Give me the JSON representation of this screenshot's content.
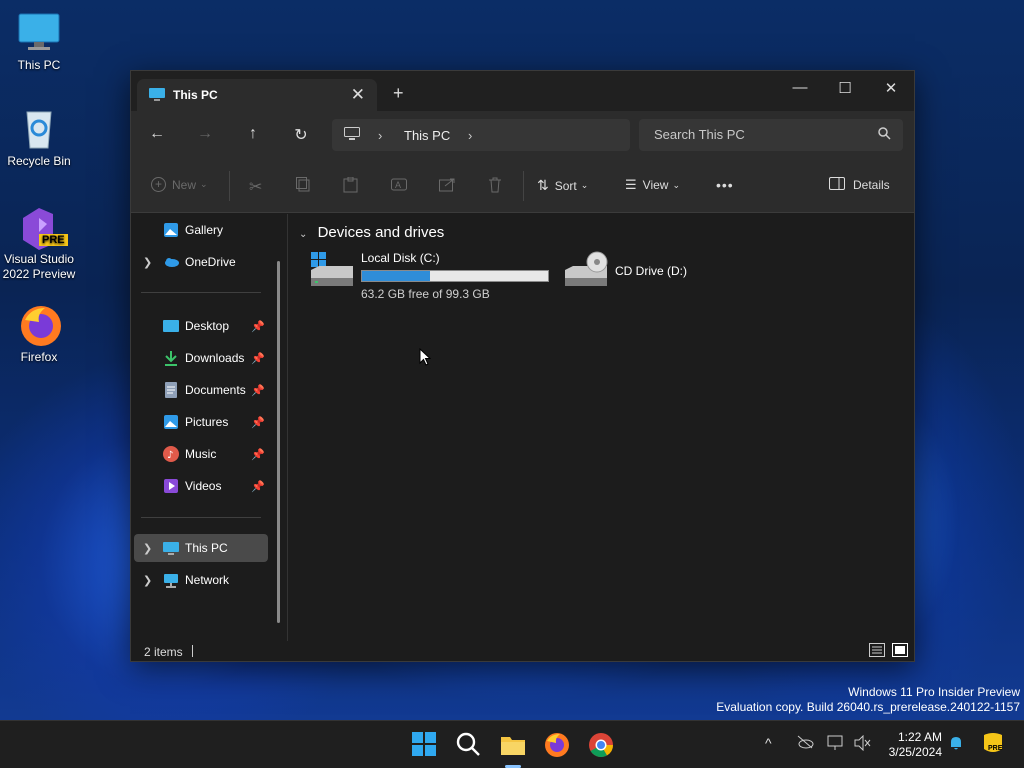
{
  "desktop": {
    "icons": [
      {
        "label": "This PC"
      },
      {
        "label": "Recycle Bin"
      },
      {
        "label": "Visual Studio 2022 Preview",
        "badge": "PRE"
      },
      {
        "label": "Firefox"
      }
    ]
  },
  "window": {
    "tab_title": "This PC",
    "new_tab": "+",
    "controls": {
      "minimize": "—",
      "maximize": "☐",
      "close": "✕"
    }
  },
  "nav": {
    "back": "←",
    "forward": "→",
    "up": "↑",
    "refresh": "↻",
    "breadcrumb": [
      "This PC"
    ],
    "chevron": "›",
    "search_placeholder": "Search This PC"
  },
  "toolbar": {
    "new_label": "New",
    "sort_label": "Sort",
    "view_label": "View",
    "more_label": "•••",
    "details_label": "Details"
  },
  "sidebar": {
    "top_items": [
      {
        "label": "Gallery",
        "icon": "gallery-icon"
      },
      {
        "label": "OneDrive",
        "icon": "cloud-icon"
      }
    ],
    "quick_access": [
      {
        "label": "Desktop",
        "icon": "desktop-folder-icon"
      },
      {
        "label": "Downloads",
        "icon": "download-icon"
      },
      {
        "label": "Documents",
        "icon": "documents-icon"
      },
      {
        "label": "Pictures",
        "icon": "pictures-icon"
      },
      {
        "label": "Music",
        "icon": "music-icon"
      },
      {
        "label": "Videos",
        "icon": "videos-icon"
      }
    ],
    "locations": [
      {
        "label": "This PC",
        "icon": "computer-icon",
        "selected": true
      },
      {
        "label": "Network",
        "icon": "network-icon"
      }
    ]
  },
  "content": {
    "group_title": "Devices and drives",
    "drives": [
      {
        "name": "Local Disk (C:)",
        "free_text": "63.2 GB free of 99.3 GB",
        "used_fraction": 0.364
      },
      {
        "name": "CD Drive (D:)"
      }
    ]
  },
  "status": {
    "item_count": "2 items"
  },
  "watermark": {
    "line1": "Windows 11 Pro Insider Preview",
    "line2": "Evaluation copy. Build 26040.rs_prerelease.240122-1157"
  },
  "taskbar": {
    "time": "1:22 AM",
    "date": "3/25/2024",
    "tray_chevron": "^",
    "tray_badge": "PRE"
  },
  "colors": {
    "accent": "#2f8dd8",
    "selected_bg": "#4a4a4a",
    "window_bg": "#1c1c1c"
  }
}
